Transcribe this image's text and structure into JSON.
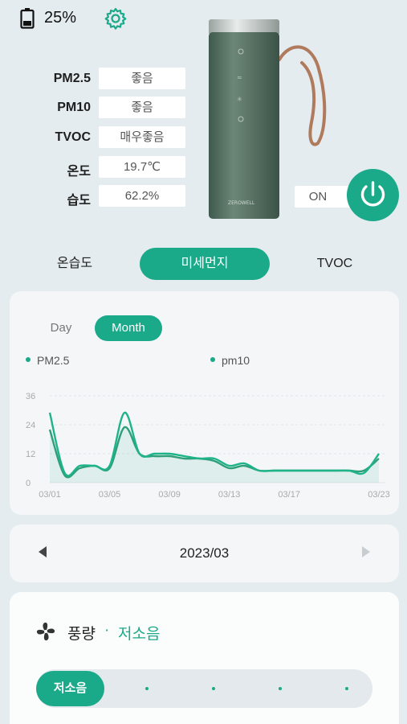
{
  "status": {
    "battery_percent": "25%",
    "battery_icon": "battery-icon",
    "settings_icon": "gear-icon"
  },
  "sensors": [
    {
      "label": "PM2.5",
      "value": "좋음"
    },
    {
      "label": "PM10",
      "value": "좋음"
    },
    {
      "label": "TVOC",
      "value": "매우좋음"
    },
    {
      "label": "온도",
      "value": "19.7℃"
    },
    {
      "label": "습도",
      "value": "62.2%"
    }
  ],
  "device": {
    "brand_label": "ZEROWELL"
  },
  "power": {
    "state_label": "ON",
    "icon": "power-icon"
  },
  "tabs": [
    {
      "label": "온습도",
      "active": false
    },
    {
      "label": "미세먼지",
      "active": true
    },
    {
      "label": "TVOC",
      "active": false
    }
  ],
  "chart_controls": {
    "day_label": "Day",
    "month_label": "Month",
    "selected": "Month"
  },
  "chart_data": {
    "type": "line",
    "x": [
      "03/01",
      "03/02",
      "03/03",
      "03/04",
      "03/05",
      "03/06",
      "03/07",
      "03/08",
      "03/09",
      "03/10",
      "03/11",
      "03/12",
      "03/13",
      "03/14",
      "03/15",
      "03/16",
      "03/17",
      "03/18",
      "03/19",
      "03/20",
      "03/21",
      "03/22",
      "03/23"
    ],
    "x_ticks": [
      "03/01",
      "03/05",
      "03/09",
      "03/13",
      "03/17",
      "03/23"
    ],
    "y_ticks": [
      "0",
      "12",
      "24",
      "36"
    ],
    "ylim": [
      0,
      36
    ],
    "series": [
      {
        "name": "PM2.5",
        "values": [
          22,
          3,
          6,
          7,
          6,
          23,
          12,
          11,
          11,
          10,
          10,
          9,
          6,
          7,
          5,
          5,
          5,
          5,
          5,
          5,
          5,
          5,
          10
        ]
      },
      {
        "name": "pm10",
        "values": [
          29,
          4,
          7,
          7,
          7,
          29,
          12,
          12,
          12,
          11,
          10,
          10,
          7,
          8,
          5,
          5,
          5,
          5,
          5,
          5,
          5,
          4,
          12
        ]
      }
    ],
    "legend_position": "top",
    "grid": true,
    "colors": {
      "PM2.5": "#2e9f78",
      "pm10": "#1fb38a"
    }
  },
  "date_nav": {
    "current": "2023/03"
  },
  "fan": {
    "icon": "fan-icon",
    "label": "풍량",
    "separator": "·",
    "mode": "저소음",
    "slider_selected": "저소음",
    "slider_steps": 5
  },
  "colors": {
    "accent": "#1aa989",
    "background": "#e4ecef"
  }
}
